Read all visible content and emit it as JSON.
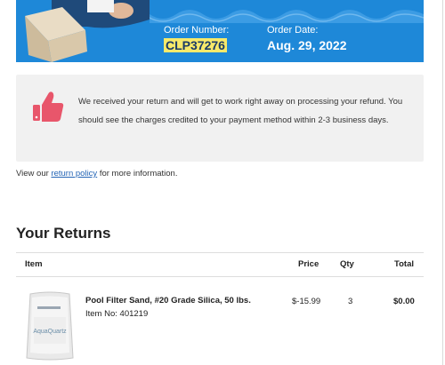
{
  "order": {
    "number_label": "Order Number:",
    "number": "CLP37276",
    "date_label": "Order Date:",
    "date": "Aug. 29, 2022"
  },
  "notice": {
    "text": "We received your return and will get to work right away on processing your refund. You should see the charges credited to your payment method within 2-3 business days.",
    "icon": "thumbs-up-icon",
    "icon_color": "#e8566b"
  },
  "policy": {
    "prefix": "View our ",
    "link": "return policy",
    "suffix": " for more information."
  },
  "returns": {
    "title": "Your Returns",
    "columns": {
      "item": "Item",
      "price": "Price",
      "qty": "Qty",
      "total": "Total"
    },
    "rows": [
      {
        "name": "Pool Filter Sand, #20 Grade Silica, 50 lbs.",
        "item_no": "Item No: 401219",
        "price": "$-15.99",
        "qty": "3",
        "total": "$0.00",
        "bag_text": "AquaQuartz"
      }
    ]
  },
  "colors": {
    "banner": "#1e88d8",
    "highlight": "#f7e96a",
    "link": "#2364b5",
    "info_bg": "#f1f1f1"
  }
}
